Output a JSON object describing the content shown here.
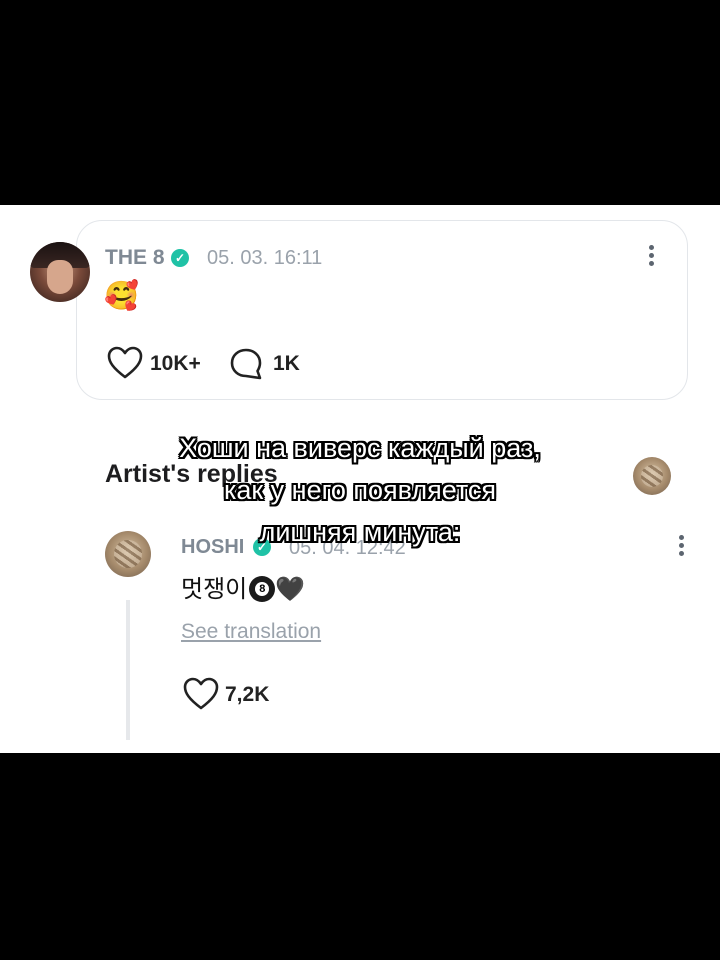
{
  "post": {
    "author": "THE 8",
    "date": "05. 03. 16:11",
    "content_emoji": "🥰",
    "likes": "10K+",
    "comments": "1K"
  },
  "section": {
    "heading": "Artist's replies",
    "heading_visible": "Artist's replies"
  },
  "reply": {
    "author": "HOSHI",
    "date": "05. 04. 12:42",
    "text": "멋쟁이",
    "ball_number": "8",
    "heart_emoji": "🖤",
    "translate_label": "See translation",
    "likes": "7,2K"
  },
  "caption": {
    "line1": "Хоши на виверс каждый раз,",
    "line2": "как у него появляется",
    "line3": "лишняя минута:"
  },
  "icons": [
    "heart-icon",
    "comment-icon",
    "verified-icon",
    "more-icon"
  ],
  "colors": {
    "verified": "#1fc2a6",
    "name": "#7f8994",
    "date": "#9aa2ab"
  }
}
